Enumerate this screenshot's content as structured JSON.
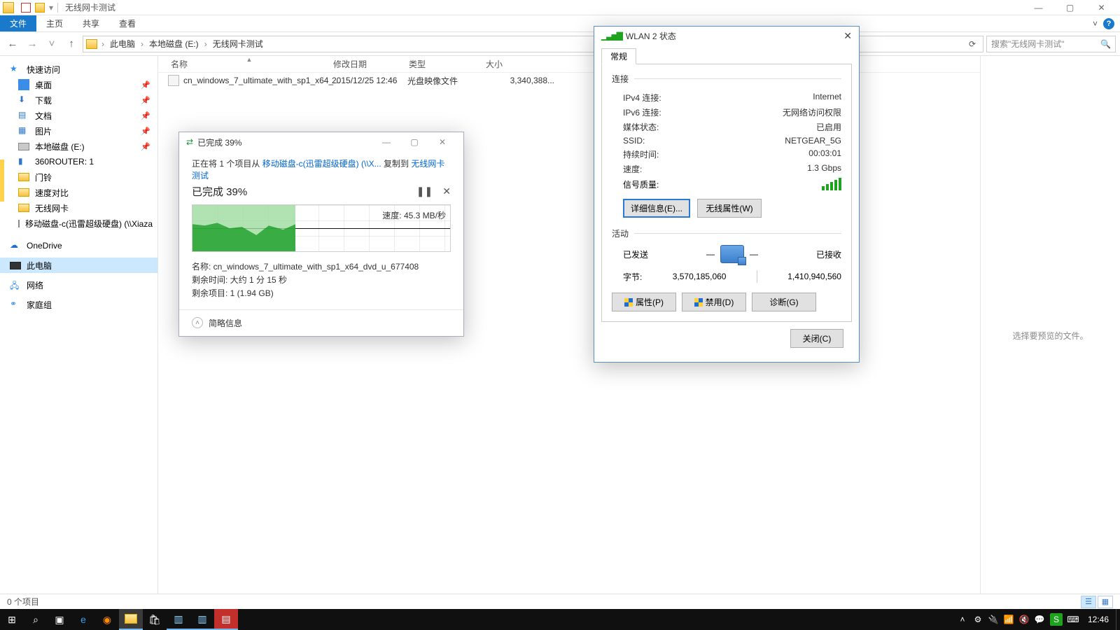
{
  "window": {
    "title": "无线网卡测试"
  },
  "ribbon": {
    "file": "文件",
    "tabs": [
      "主页",
      "共享",
      "查看"
    ],
    "caret": "˅"
  },
  "address": {
    "crumbs": [
      "此电脑",
      "本地磁盘 (E:)",
      "无线网卡测试"
    ],
    "search_placeholder": "搜索\"无线网卡测试\""
  },
  "sidebar": {
    "quick": "快速访问",
    "items": [
      "桌面",
      "下载",
      "文档",
      "图片",
      "本地磁盘 (E:)",
      "360ROUTER: 1",
      "门铃",
      "速度对比",
      "无线网卡",
      "移动磁盘-c(迅雷超级硬盘) (\\\\Xiaza"
    ],
    "onedrive": "OneDrive",
    "thispc": "此电脑",
    "network": "网络",
    "homegroup": "家庭组"
  },
  "columns": {
    "name": "名称",
    "date": "修改日期",
    "type": "类型",
    "size": "大小"
  },
  "files": [
    {
      "name": "cn_windows_7_ultimate_with_sp1_x64_...",
      "date": "2015/12/25 12:46",
      "type": "光盘映像文件",
      "size": "3,340,388..."
    }
  ],
  "preview": {
    "empty": "选择要预览的文件。"
  },
  "statusbar": {
    "count": "0 个项目"
  },
  "copy": {
    "title": "已完成 39%",
    "moving_prefix": "正在将 1 个项目从 ",
    "src": "移动磁盘-c(迅雷超级硬盘) (\\\\X...",
    "mid": " 复制到 ",
    "dst": "无线网卡测试",
    "progress": "已完成 39%",
    "speed": "速度: 45.3 MB/秒",
    "name_lbl": "名称: ",
    "name_val": "cn_windows_7_ultimate_with_sp1_x64_dvd_u_677408",
    "remain_lbl": "剩余时间: ",
    "remain_val": "大约 1 分 15 秒",
    "items_lbl": "剩余项目: ",
    "items_val": "1 (1.94 GB)",
    "less": "简略信息"
  },
  "wlan": {
    "title": "WLAN 2 状态",
    "tab": "常规",
    "grp_conn": "连接",
    "rows": {
      "ipv4_lbl": "IPv4 连接:",
      "ipv4_val": "Internet",
      "ipv6_lbl": "IPv6 连接:",
      "ipv6_val": "无网络访问权限",
      "media_lbl": "媒体状态:",
      "media_val": "已启用",
      "ssid_lbl": "SSID:",
      "ssid_val": "NETGEAR_5G",
      "dur_lbl": "持续时间:",
      "dur_val": "00:03:01",
      "spd_lbl": "速度:",
      "spd_val": "1.3 Gbps",
      "sig_lbl": "信号质量:"
    },
    "btn_detail": "详细信息(E)...",
    "btn_wprop": "无线属性(W)",
    "grp_act": "活动",
    "sent": "已发送",
    "recv": "已接收",
    "bytes_lbl": "字节:",
    "bytes_sent": "3,570,185,060",
    "bytes_recv": "1,410,940,560",
    "btn_prop": "属性(P)",
    "btn_disable": "禁用(D)",
    "btn_diag": "诊断(G)",
    "btn_close": "关闭(C)"
  },
  "taskbar": {
    "clock": "12:46"
  }
}
